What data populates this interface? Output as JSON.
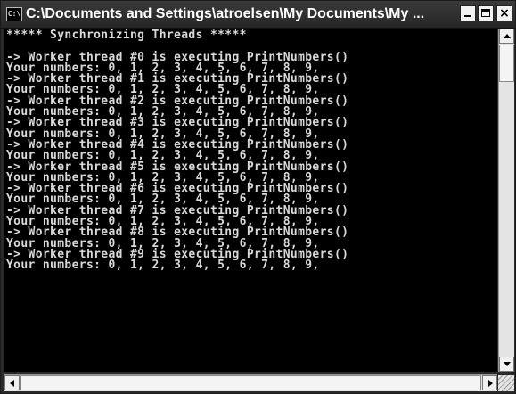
{
  "window": {
    "title": "C:\\Documents and Settings\\atroelsen\\My Documents\\My ...",
    "icon": "console-icon",
    "icon_text": "C:\\"
  },
  "titlebar_buttons": {
    "minimize": "minimize-icon",
    "maximize": "maximize-icon",
    "close": "close-icon",
    "close_glyph": "×"
  },
  "console": {
    "lines": [
      "***** Synchronizing Threads *****",
      "",
      "-> Worker thread #0 is executing PrintNumbers()",
      "Your numbers: 0, 1, 2, 3, 4, 5, 6, 7, 8, 9,",
      "-> Worker thread #1 is executing PrintNumbers()",
      "Your numbers: 0, 1, 2, 3, 4, 5, 6, 7, 8, 9,",
      "-> Worker thread #2 is executing PrintNumbers()",
      "Your numbers: 0, 1, 2, 3, 4, 5, 6, 7, 8, 9,",
      "-> Worker thread #3 is executing PrintNumbers()",
      "Your numbers: 0, 1, 2, 3, 4, 5, 6, 7, 8, 9,",
      "-> Worker thread #4 is executing PrintNumbers()",
      "Your numbers: 0, 1, 2, 3, 4, 5, 6, 7, 8, 9,",
      "-> Worker thread #5 is executing PrintNumbers()",
      "Your numbers: 0, 1, 2, 3, 4, 5, 6, 7, 8, 9,",
      "-> Worker thread #6 is executing PrintNumbers()",
      "Your numbers: 0, 1, 2, 3, 4, 5, 6, 7, 8, 9,",
      "-> Worker thread #7 is executing PrintNumbers()",
      "Your numbers: 0, 1, 2, 3, 4, 5, 6, 7, 8, 9,",
      "-> Worker thread #8 is executing PrintNumbers()",
      "Your numbers: 0, 1, 2, 3, 4, 5, 6, 7, 8, 9,",
      "-> Worker thread #9 is executing PrintNumbers()",
      "Your numbers: 0, 1, 2, 3, 4, 5, 6, 7, 8, 9,"
    ]
  },
  "colors": {
    "console_background": "#000000",
    "console_text": "#d9d9d9",
    "titlebar": "#2f2f2f"
  }
}
